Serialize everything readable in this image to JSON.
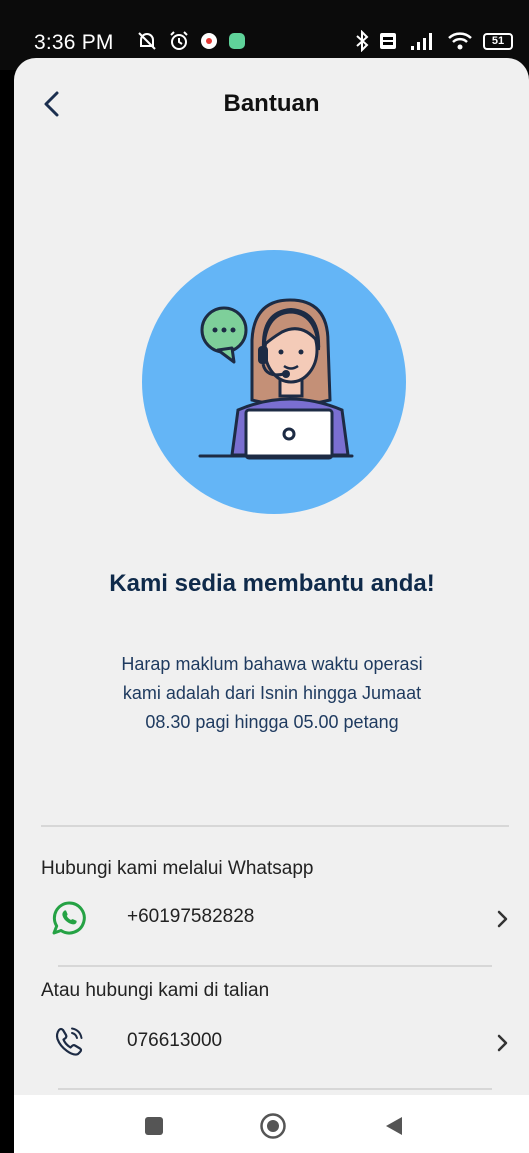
{
  "status_bar": {
    "time": "3:36 PM",
    "battery": "51"
  },
  "header": {
    "title": "Bantuan"
  },
  "main": {
    "headline": "Kami sedia membantu anda!",
    "hours": "Harap maklum bahawa waktu operasi kami adalah dari Isnin hingga Jumaat 08.30 pagi hingga 05.00 petang"
  },
  "contacts": {
    "whatsapp_label": "Hubungi kami melalui Whatsapp",
    "whatsapp_number": "+60197582828",
    "phone_label": "Atau hubungi kami di talian",
    "phone_number": "076613000"
  },
  "colors": {
    "illustration_bg": "#64b5f6",
    "whatsapp_green": "#25a244",
    "headline_navy": "#0f2a4a"
  }
}
